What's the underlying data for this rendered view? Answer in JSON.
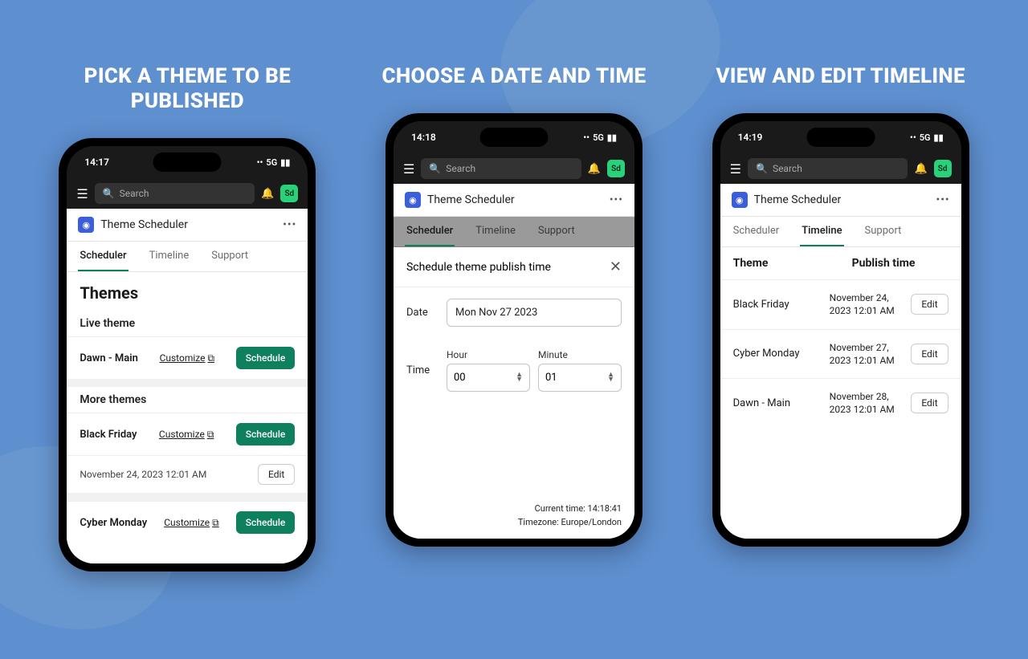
{
  "headings": [
    "PICK A THEME TO BE PUBLISHED",
    "CHOOSE A DATE AND TIME",
    "VIEW AND EDIT TIMELINE"
  ],
  "status": {
    "t1": "14:17",
    "t2": "14:18",
    "t3": "14:19",
    "net": "5G"
  },
  "search_placeholder": "Search",
  "avatar": "Sd",
  "app_title": "Theme Scheduler",
  "tabs": [
    "Scheduler",
    "Timeline",
    "Support"
  ],
  "p1": {
    "title": "Themes",
    "live_label": "Live theme",
    "more_label": "More themes",
    "customize": "Customize",
    "schedule": "Schedule",
    "edit": "Edit",
    "live_theme": "Dawn - Main",
    "rows": [
      {
        "name": "Black Friday",
        "meta": "November 24, 2023 12:01 AM"
      },
      {
        "name": "Cyber Monday"
      }
    ]
  },
  "p2": {
    "modal_title": "Schedule theme publish time",
    "date_label": "Date",
    "date_value": "Mon Nov 27 2023",
    "time_label": "Time",
    "hour_label": "Hour",
    "minute_label": "Minute",
    "hour": "00",
    "minute": "01",
    "current": "Current time: 14:18:41",
    "tz": "Timezone: Europe/London"
  },
  "p3": {
    "col1": "Theme",
    "col2": "Publish time",
    "edit": "Edit",
    "rows": [
      {
        "name": "Black Friday",
        "time": "November 24, 2023 12:01 AM"
      },
      {
        "name": "Cyber Monday",
        "time": "November 27, 2023 12:01 AM"
      },
      {
        "name": "Dawn - Main",
        "time": "November 28, 2023 12:01 AM"
      }
    ]
  }
}
